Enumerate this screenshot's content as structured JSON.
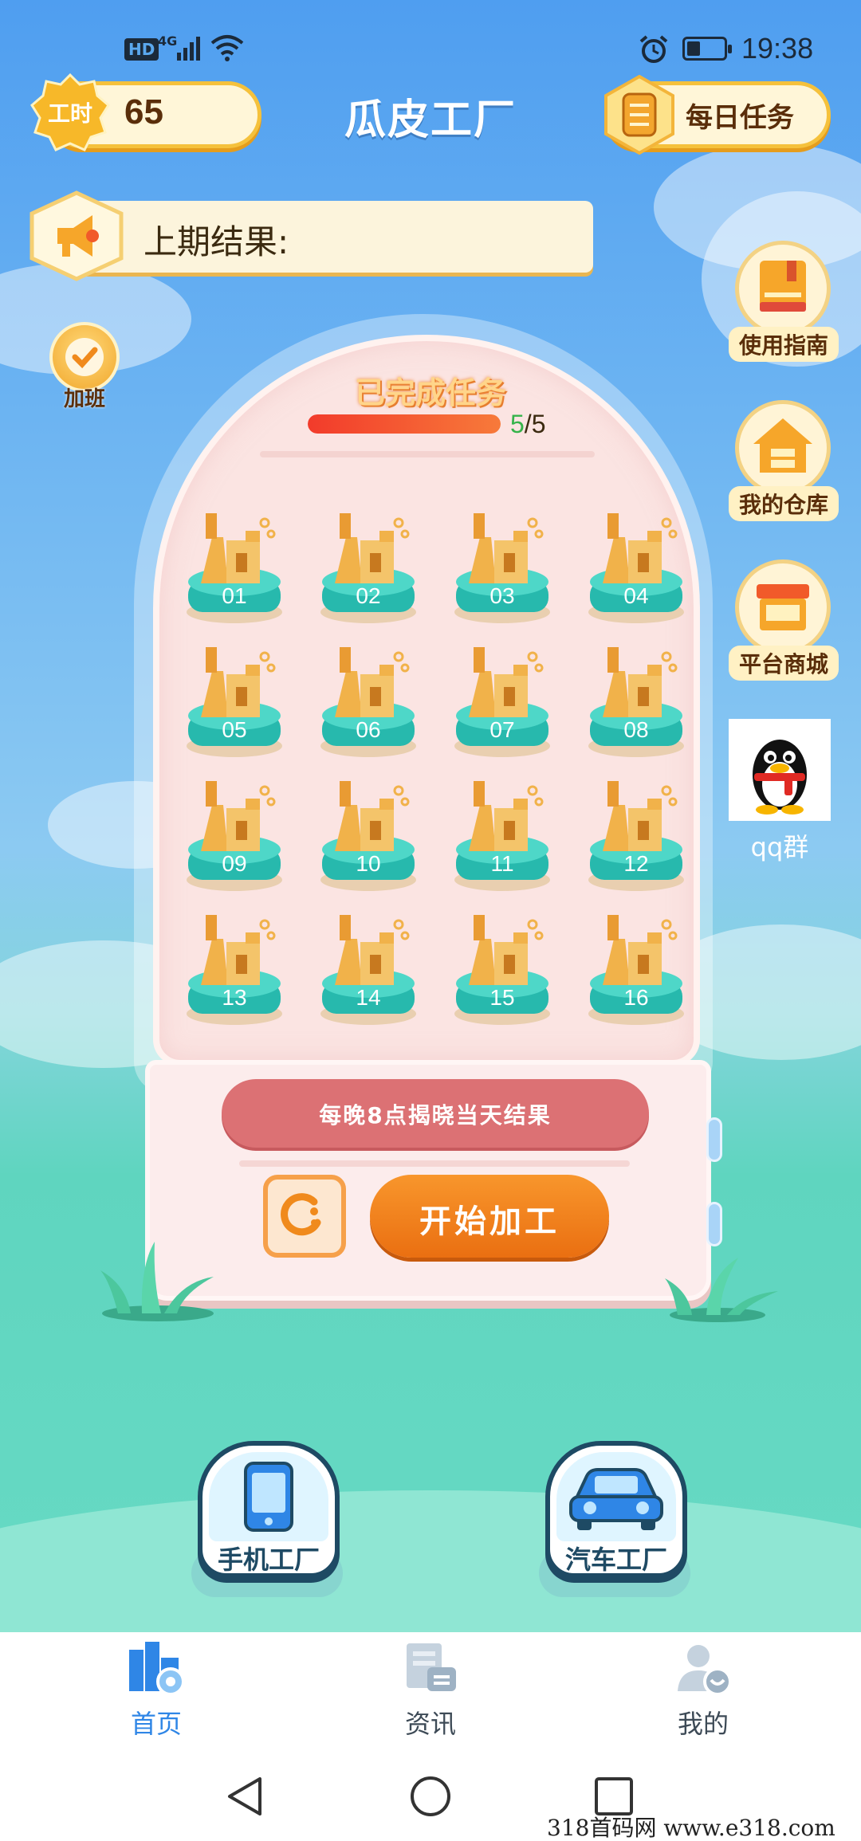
{
  "status_bar": {
    "hd": "HD",
    "network": "4G",
    "time": "19:38",
    "icons": [
      "signal-icon",
      "wifi-icon",
      "alarm-icon",
      "battery-icon"
    ]
  },
  "header": {
    "hours_badge": "工时",
    "hours_value": "65",
    "title": "瓜皮工厂",
    "daily_task": "每日任务"
  },
  "result_banner": {
    "label": "上期结果:"
  },
  "overtime": {
    "label": "加班"
  },
  "side_menu": {
    "guide": "使用指南",
    "warehouse": "我的仓库",
    "mall": "平台商城",
    "qq_group": "qq群"
  },
  "machine": {
    "done_title": "已完成任务",
    "progress_current": "5",
    "progress_total": "/5",
    "progress_fraction": 1.0,
    "slots": [
      "01",
      "02",
      "03",
      "04",
      "05",
      "06",
      "07",
      "08",
      "09",
      "10",
      "11",
      "12",
      "13",
      "14",
      "15",
      "16"
    ],
    "reveal_text": "每晚8点揭晓当天结果",
    "start_label": "开始加工"
  },
  "factories": {
    "phone": "手机工厂",
    "car": "汽车工厂"
  },
  "tabs": [
    {
      "label": "首页",
      "icon": "factory-icon",
      "active": true
    },
    {
      "label": "资讯",
      "icon": "news-icon",
      "active": false
    },
    {
      "label": "我的",
      "icon": "user-icon",
      "active": false
    }
  ],
  "watermark": "318首码网  www.e318.com",
  "colors": {
    "accent_orange": "#ea6f11",
    "tab_active": "#2f86e6",
    "tab_inactive": "#3d4a56",
    "reveal_pink": "#dc7174"
  }
}
